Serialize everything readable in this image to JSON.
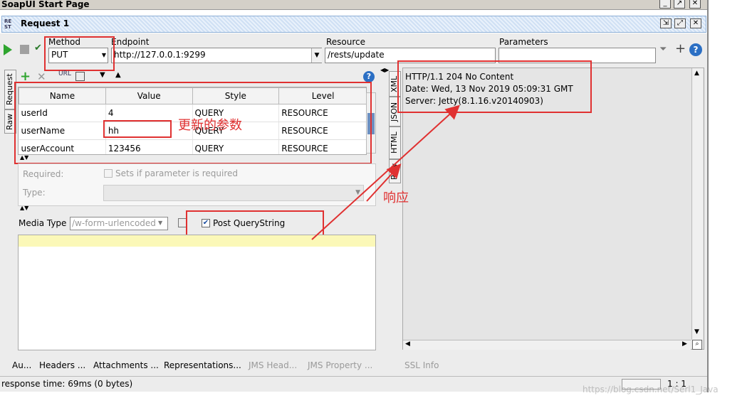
{
  "window": {
    "outer_title": "SoapUI Start Page",
    "request_title": "Request 1",
    "rest_badge": "RE ST"
  },
  "toolbar": {
    "method_label": "Method",
    "method_value": "PUT",
    "endpoint_label": "Endpoint",
    "endpoint_value": "http://127.0.0.1:9299",
    "resource_label": "Resource",
    "resource_value": "/rests/update",
    "parameters_label": "Parameters",
    "parameters_value": ""
  },
  "left_tabs": [
    "Request",
    "Raw"
  ],
  "right_tabs": [
    "XML",
    "JSON",
    "HTML",
    "Raw"
  ],
  "params_table": {
    "columns": [
      "Name",
      "Value",
      "Style",
      "Level"
    ],
    "rows": [
      {
        "name": "userId",
        "value": "4",
        "style": "QUERY",
        "level": "RESOURCE"
      },
      {
        "name": "userName",
        "value": "hh",
        "style": "QUERY",
        "level": "RESOURCE"
      },
      {
        "name": "userAccount",
        "value": "123456",
        "style": "QUERY",
        "level": "RESOURCE"
      }
    ]
  },
  "param_details": {
    "required_label": "Required:",
    "required_checkbox_label": "Sets if parameter is required",
    "type_label": "Type:"
  },
  "media": {
    "label": "Media Type",
    "value": "/w-form-urlencoded",
    "post_qs_label": "Post QueryString",
    "post_qs_checked": true
  },
  "response": {
    "lines": [
      "HTTP/1.1 204 No Content",
      "Date: Wed, 13 Nov 2019 05:09:31 GMT",
      "Server: Jetty(8.1.16.v20140903)"
    ]
  },
  "bottom_tabs_left": [
    "Au...",
    "Headers ...",
    "Attachments ...",
    "Representations...",
    "JMS Head...",
    "JMS Property ..."
  ],
  "bottom_tabs_right": [
    "SSL Info"
  ],
  "status": {
    "response_time": "response time: 69ms (0 bytes)",
    "position": "1 : 1"
  },
  "annotations": {
    "updated_params": "更新的参数",
    "response": "响应"
  },
  "watermark": "https://blog.csdn.net/Serl1_Java",
  "colors": {
    "annotation_red": "#e03131",
    "editor_yellow": "#fbf8b8",
    "play_green": "#2fa52f"
  }
}
